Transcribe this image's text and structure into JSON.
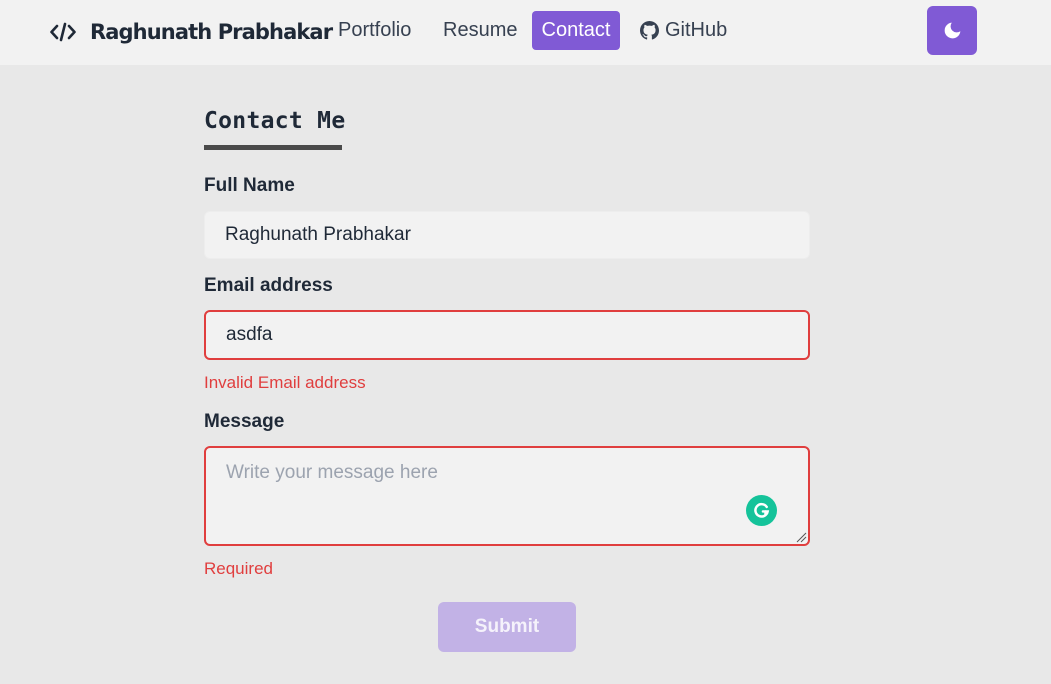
{
  "header": {
    "brand_name": "Raghunath Prabhakar",
    "brand_icon": "code-icon",
    "nav": {
      "portfolio": "Portfolio",
      "resume": "Resume",
      "contact": "Contact",
      "github": "GitHub"
    },
    "active_nav": "Contact",
    "github_icon": "github-icon",
    "theme_toggle_icon": "moon-icon"
  },
  "form": {
    "title": "Contact Me",
    "full_name": {
      "label": "Full Name",
      "value": "Raghunath Prabhakar"
    },
    "email": {
      "label": "Email address",
      "value": "asdfa",
      "error": "Invalid Email address"
    },
    "message": {
      "label": "Message",
      "value": "",
      "placeholder": "Write your message here",
      "error": "Required"
    },
    "submit_label": "Submit"
  },
  "colors": {
    "accent": "#805ad5",
    "error": "#e03e3e",
    "page_bg": "#e8e8e8",
    "header_bg": "#f2f2f2",
    "submit_disabled": "#c2b2e6",
    "grammarly": "#15c39a"
  }
}
